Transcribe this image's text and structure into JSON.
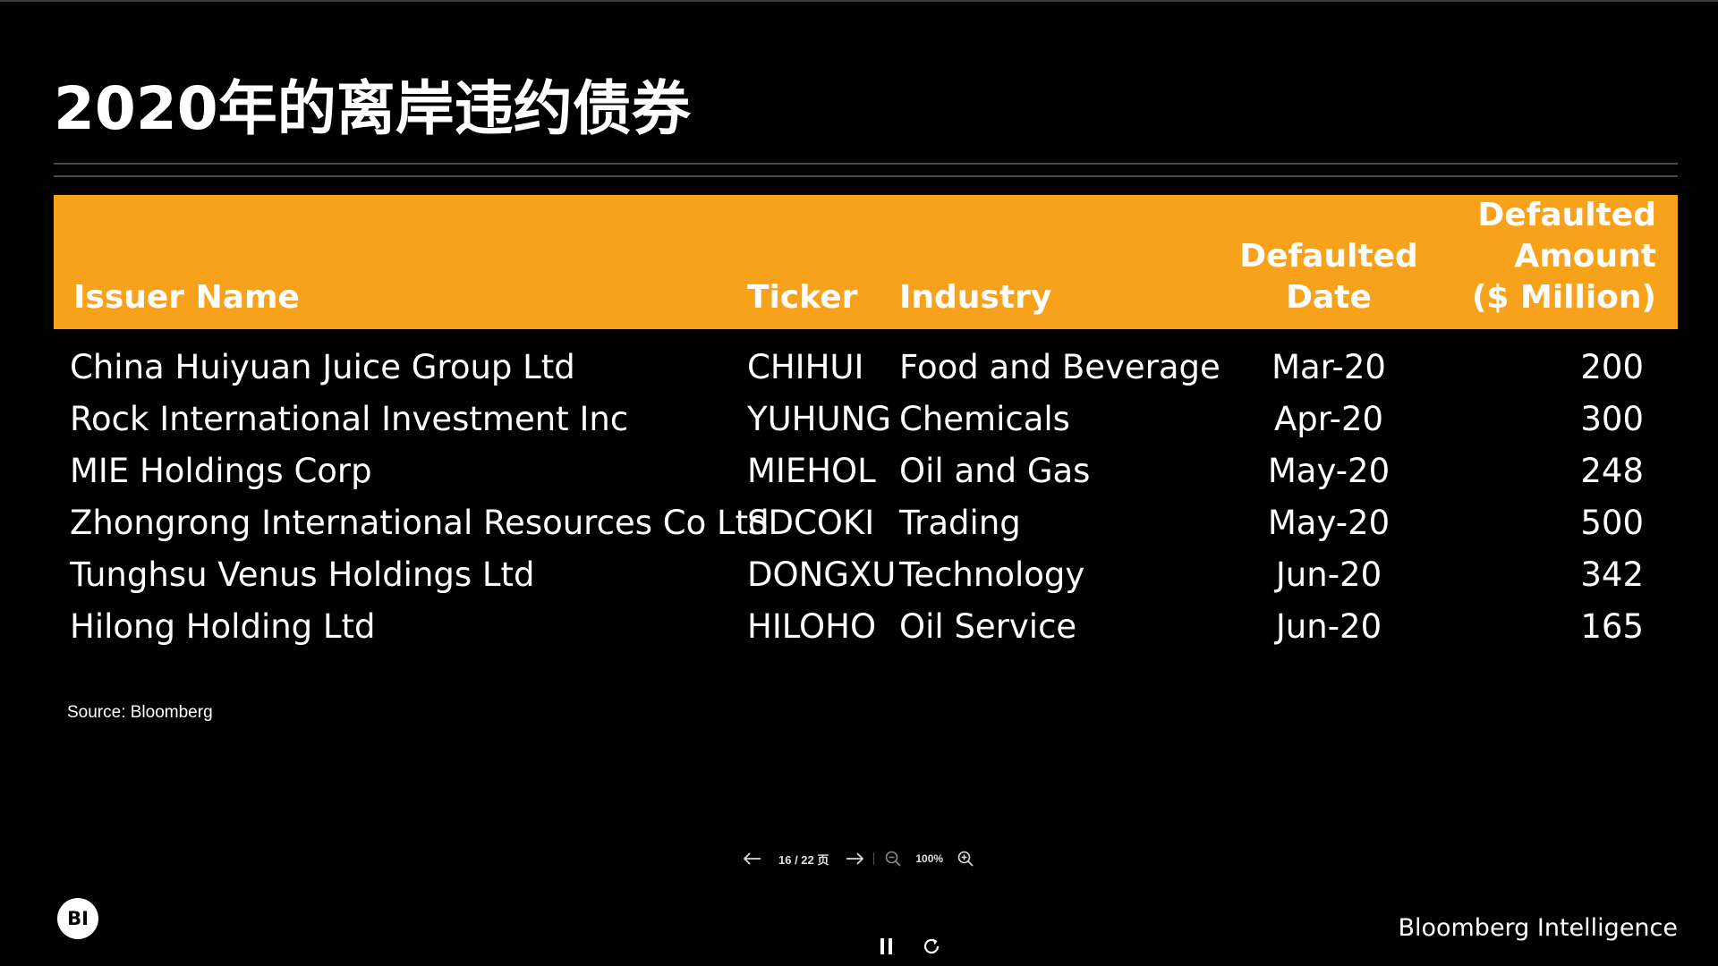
{
  "slide": {
    "title": "2020年的离岸违约债券",
    "source": "Source: Bloomberg",
    "brand": "Bloomberg Intelligence",
    "logo_text": "BI"
  },
  "table": {
    "headers": {
      "issuer": [
        "",
        "",
        "Issuer Name"
      ],
      "ticker": [
        "",
        "",
        "Ticker"
      ],
      "industry": [
        "",
        "",
        "Industry"
      ],
      "date": [
        "",
        "Defaulted",
        "Date"
      ],
      "amount": [
        "Defaulted",
        "Amount",
        "($ Million)"
      ]
    },
    "rows": [
      {
        "issuer": "China Huiyuan Juice Group Ltd",
        "ticker": "CHIHUI",
        "industry": "Food and Beverage",
        "date": "Mar-20",
        "amount": "200"
      },
      {
        "issuer": "Rock International Investment Inc",
        "ticker": "YUHUNG",
        "industry": "Chemicals",
        "date": "Apr-20",
        "amount": "300"
      },
      {
        "issuer": "MIE Holdings Corp",
        "ticker": "MIEHOL",
        "industry": "Oil and Gas",
        "date": "May-20",
        "amount": "248"
      },
      {
        "issuer": "Zhongrong International Resources Co Ltd",
        "ticker": "SDCOKI",
        "industry": "Trading",
        "date": "May-20",
        "amount": "500"
      },
      {
        "issuer": "Tunghsu Venus Holdings Ltd",
        "ticker": "DONGXU",
        "industry": "Technology",
        "date": "Jun-20",
        "amount": "342"
      },
      {
        "issuer": "Hilong Holding Ltd",
        "ticker": "HILOHO",
        "industry": "Oil Service",
        "date": "Jun-20",
        "amount": "165"
      }
    ]
  },
  "viewer": {
    "page_indicator": "16 / 22 页",
    "zoom_level": "100%",
    "icons": {
      "prev": "arrow-left-icon",
      "next": "arrow-right-icon",
      "zoom_out": "zoom-out-icon",
      "zoom_in": "zoom-in-icon",
      "pause": "pause-icon",
      "reload": "reload-icon"
    }
  },
  "colors": {
    "background": "#000000",
    "header_fill": "#f8a11b",
    "text": "#ffffff"
  }
}
